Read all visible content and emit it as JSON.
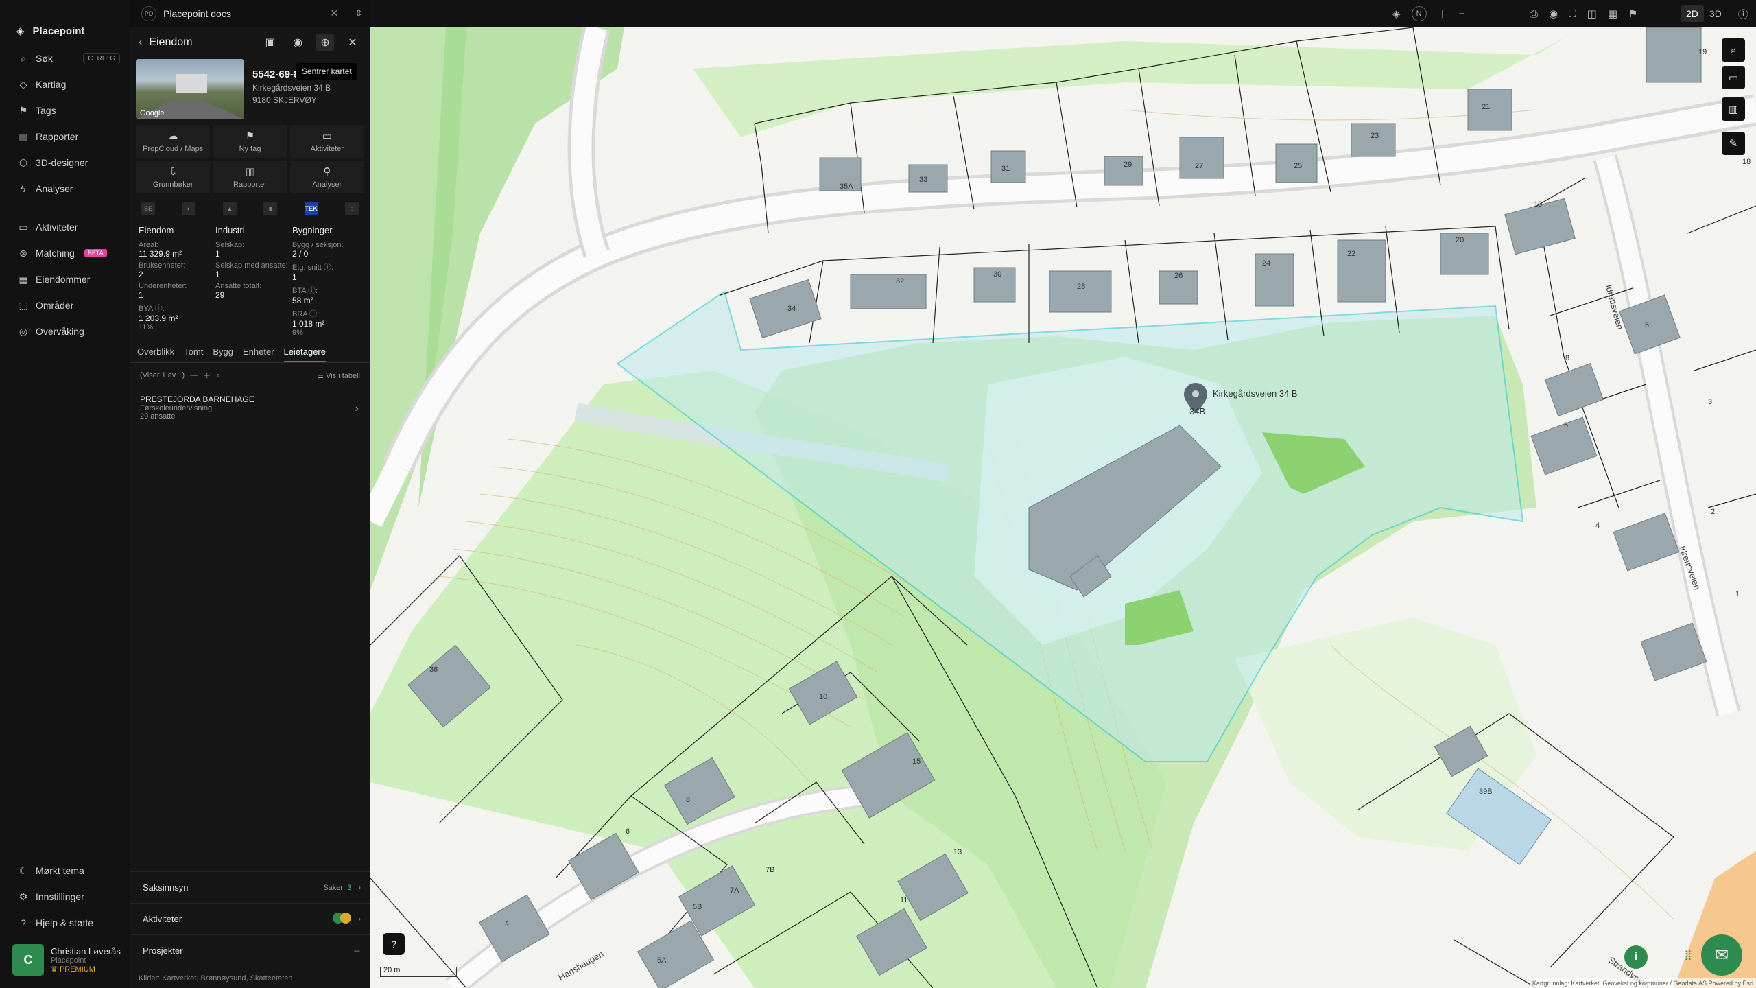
{
  "brand": {
    "name": "Placepoint"
  },
  "nav": {
    "items": [
      {
        "label": "Søk",
        "shortcut": "CTRL+G"
      },
      {
        "label": "Kartlag"
      },
      {
        "label": "Tags"
      },
      {
        "label": "Rapporter"
      },
      {
        "label": "3D-designer"
      },
      {
        "label": "Analyser"
      },
      {
        "label": "Aktiviteter"
      },
      {
        "label": "Matching",
        "badge": "BETA"
      },
      {
        "label": "Eiendommer"
      },
      {
        "label": "Områder"
      },
      {
        "label": "Overvåking"
      }
    ],
    "bottom": [
      {
        "label": "Mørkt tema"
      },
      {
        "label": "Innstillinger"
      },
      {
        "label": "Hjelp & støtte"
      }
    ],
    "user": {
      "initial": "C",
      "name": "Christian Løverås",
      "org": "Placepoint",
      "plan": "PREMIUM"
    }
  },
  "doctab": {
    "initials": "PD",
    "title": "Placepoint docs"
  },
  "panel": {
    "title": "Eiendom",
    "tooltip": "Sentrer kartet",
    "id": "5542-69-887-0-0",
    "address": "Kirkegårdsveien 34 B",
    "postal": "9180 SKJERVØY",
    "photo_label": "Google",
    "tiles": [
      {
        "label": "PropCloud / Maps",
        "icon": "☁"
      },
      {
        "label": "Ny tag",
        "icon": "⚑"
      },
      {
        "label": "Aktiviteter",
        "icon": "▭"
      },
      {
        "label": "Grunnbøker",
        "icon": "⇩"
      },
      {
        "label": "Rapporter",
        "icon": "▥"
      },
      {
        "label": "Analyser",
        "icon": "⚲"
      }
    ],
    "sources": [
      "SE",
      "◐",
      "▲",
      "▮",
      "TEK",
      "⌂"
    ],
    "stats": {
      "eiendom": {
        "heading": "Eiendom",
        "areal_label": "Areal:",
        "areal": "11 329.9 m²",
        "bruks_label": "Bruksenheter:",
        "bruks": "2",
        "under_label": "Underenheter:",
        "under": "1",
        "bya_label": "BYA ⓘ:",
        "bya": "1 203.9 m²",
        "bya_pct": "11%"
      },
      "industri": {
        "heading": "Industri",
        "selskap_label": "Selskap:",
        "selskap": "1",
        "ansatte_label": "Selskap med ansatte:",
        "ansatte": "1",
        "totalt_label": "Ansatte totalt:",
        "totalt": "29"
      },
      "bygninger": {
        "heading": "Bygninger",
        "bygg_label": "Bygg / seksjon:",
        "bygg": "2 / 0",
        "etg_label": "Etg. snitt ⓘ:",
        "etg": "1",
        "bta_label": "BTA ⓘ:",
        "bta": "58 m²",
        "bra_label": "BRA ⓘ:",
        "bra": "1 018 m²",
        "bra_pct": "9%"
      }
    },
    "tabs": [
      "Overblikk",
      "Tomt",
      "Bygg",
      "Enheter",
      "Leietagere"
    ],
    "list_status": "(Viser 1 av 1)",
    "table_link": "Vis i tabell",
    "tenant": {
      "name": "PRESTEJORDA BARNEHAGE",
      "sector": "Førskoleundervisning",
      "employees": "29 ansatte"
    },
    "accordions": {
      "saksinnsyn": {
        "label": "Saksinnsyn",
        "count_label": "Saker:",
        "count": "3"
      },
      "aktiviteter": {
        "label": "Aktiviteter"
      },
      "prosjekter": {
        "label": "Prosjekter"
      }
    },
    "sources_label": "Kilder:",
    "source_list": [
      "Kartverket,",
      "Brønnøysund,",
      "Skatteetaten"
    ]
  },
  "topbar": {
    "n_label": "N",
    "view_2d": "2D",
    "view_3d": "3D"
  },
  "map": {
    "scale": "20 m",
    "attribution": "Kartgrunnlag: Kartverket, Geovekst og kommuner / Geodata AS Powered by Esri",
    "pin_label": "34B",
    "pin_address": "Kirkegårdsveien 34 B",
    "streets": [
      "Idrettsveien",
      "Idrettsveien",
      "Hanshaugen",
      "Strandveien"
    ],
    "house_numbers": [
      "35A",
      "33",
      "31",
      "29",
      "27",
      "25",
      "23",
      "21",
      "19",
      "18",
      "34",
      "32",
      "30",
      "28",
      "26",
      "24",
      "22",
      "20",
      "10",
      "5",
      "8",
      "6",
      "4",
      "3",
      "2",
      "1",
      "36",
      "10",
      "15",
      "13",
      "11",
      "8",
      "6",
      "7B",
      "7A",
      "5B",
      "5A",
      "4",
      "39B"
    ]
  },
  "colors": {
    "accent": "#2e8b4e",
    "selection": "#1fc7d4",
    "tab_underline": "#2f7fe0",
    "beta": "#e0449b",
    "premium": "#e0a92b"
  }
}
